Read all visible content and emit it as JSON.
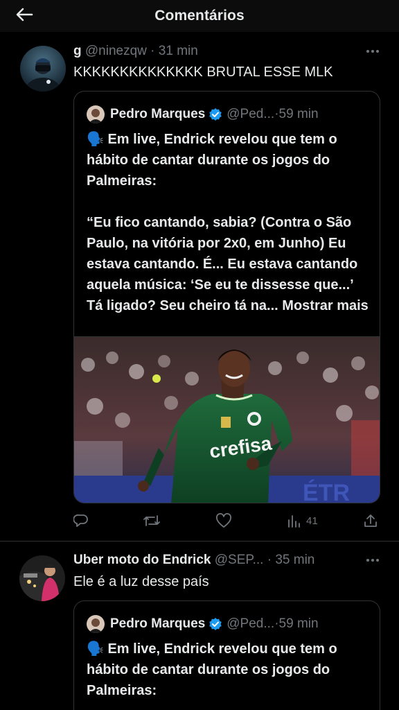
{
  "header": {
    "title": "Comentários"
  },
  "tweets": [
    {
      "display_name": "g",
      "handle": "@ninezqw",
      "separator": " · ",
      "time": "31 min",
      "text": "KKKKKKKKKKKKKK BRUTAL ESSE MLK",
      "quote": {
        "display_name": "Pedro Marques",
        "handle": "@Ped...",
        "separator": " · ",
        "time": "59 min",
        "text": "🗣️ Em live, Endrick revelou que tem o hábito de cantar durante os jogos do Palmeiras:\n\n“Eu fico cantando, sabia? (Contra o São Paulo, na vitória por 2x0, em Junho) Eu estava cantando. É... Eu estava cantando aquela música: ‘Se eu te dissesse que...’ Tá ligado? Seu cheiro tá na... ",
        "show_more": "Mostrar mais"
      },
      "actions": {
        "views": "41"
      }
    },
    {
      "display_name": "Uber moto do Endrick",
      "handle": "@SEP...",
      "separator": " · ",
      "time": "35 min",
      "text": "Ele é a luz desse país",
      "quote": {
        "display_name": "Pedro Marques",
        "handle": "@Ped...",
        "separator": " · ",
        "time": "59 min",
        "text": "🗣️ Em live, Endrick revelou que tem o hábito de cantar durante os jogos do Palmeiras:"
      }
    }
  ],
  "colors": {
    "background": "#000000",
    "text": "#e7e9ea",
    "secondary": "#71767b",
    "verified": "#1d9bf0",
    "border": "#2f3336"
  },
  "icons": [
    "back-arrow-icon",
    "more-icon",
    "verified-badge-icon",
    "reply-icon",
    "retweet-icon",
    "like-icon",
    "views-icon",
    "share-icon"
  ]
}
